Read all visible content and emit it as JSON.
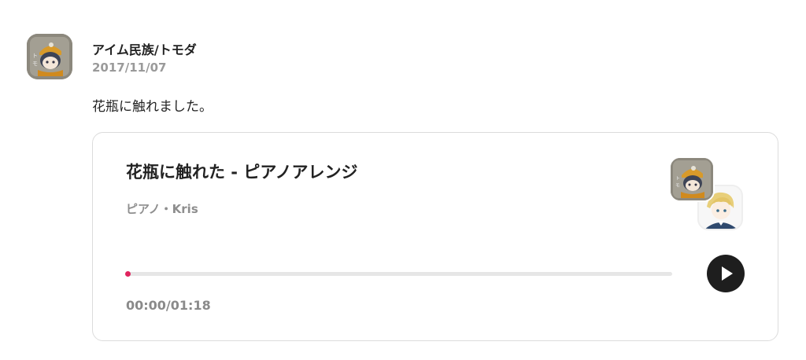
{
  "post": {
    "author": "アイム民族/トモダ",
    "date": "2017/11/07",
    "text": "花瓶に触れました。"
  },
  "track": {
    "title": "花瓶に触れた - ピアノアレンジ",
    "meta": "ピアノ・Kris",
    "progress": 0.0,
    "current_time": "00:00",
    "duration": "01:18",
    "time_readout": "00:00/01:18"
  },
  "icons": {
    "play": "play-icon",
    "author_avatar": "avatar-tomoda",
    "collab_avatar_1": "avatar-tomoda",
    "collab_avatar_2": "avatar-kris"
  },
  "colors": {
    "accent": "#e0245e",
    "play_bg": "#1e1e1e",
    "muted_text": "#8e8e8e"
  }
}
